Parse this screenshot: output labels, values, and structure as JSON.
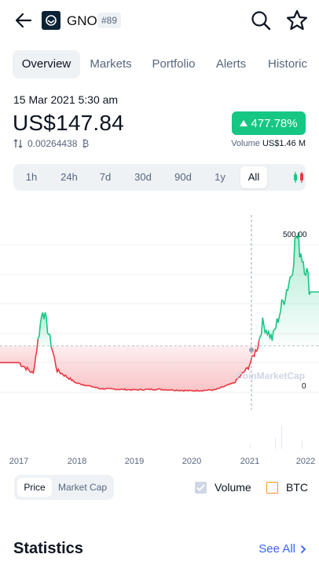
{
  "header": {
    "symbol": "GNO",
    "rank": "#89",
    "icons": [
      "arrow-left-icon",
      "coin-logo",
      "search-icon",
      "star-icon"
    ]
  },
  "tabs": [
    {
      "label": "Overview",
      "active": true
    },
    {
      "label": "Markets"
    },
    {
      "label": "Portfolio"
    },
    {
      "label": "Alerts"
    },
    {
      "label": "Historic"
    }
  ],
  "price_block": {
    "date": "15 Mar 2021 5:30 am",
    "price": "US$147.84",
    "change": "477.78%",
    "btc_value": "0.00264438",
    "btc_symbol": "₿",
    "volume_label": "Volume",
    "volume_value": "US$1.46 M"
  },
  "ranges": [
    {
      "label": "1h"
    },
    {
      "label": "24h"
    },
    {
      "label": "7d"
    },
    {
      "label": "30d"
    },
    {
      "label": "90d"
    },
    {
      "label": "1y"
    },
    {
      "label": "All",
      "active": true
    }
  ],
  "chart": {
    "watermark": "CoinMarketCap",
    "max_label": "500.00",
    "baseline_label": "0",
    "x_labels": [
      "2017",
      "2018",
      "2019",
      "2020",
      "2021",
      "2022"
    ],
    "up_color": "#16c784",
    "down_color": "#ea3943"
  },
  "chart_data": {
    "type": "area",
    "x": [
      "2017-01",
      "2017-04",
      "2017-06",
      "2017-09",
      "2018-01",
      "2018-06",
      "2019-01",
      "2019-06",
      "2020-01",
      "2020-06",
      "2020-10",
      "2021-01",
      "2021-03",
      "2021-04",
      "2021-06",
      "2021-10",
      "2021-11",
      "2022-01",
      "2022-02"
    ],
    "values": [
      95,
      60,
      270,
      70,
      30,
      12,
      8,
      10,
      5,
      8,
      30,
      80,
      148,
      220,
      170,
      380,
      500,
      400,
      320
    ],
    "baseline": 148,
    "ylim": [
      0,
      500
    ],
    "x_ticks": [
      "2017",
      "2018",
      "2019",
      "2020",
      "2021",
      "2022"
    ]
  },
  "chart_controls": {
    "modes": [
      {
        "label": "Price",
        "active": true
      },
      {
        "label": "Market Cap"
      }
    ],
    "volume_label": "Volume",
    "volume_checked": true,
    "btc_label": "BTC",
    "btc_checked": false
  },
  "statistics": {
    "title": "Statistics",
    "see_all": "See All"
  }
}
